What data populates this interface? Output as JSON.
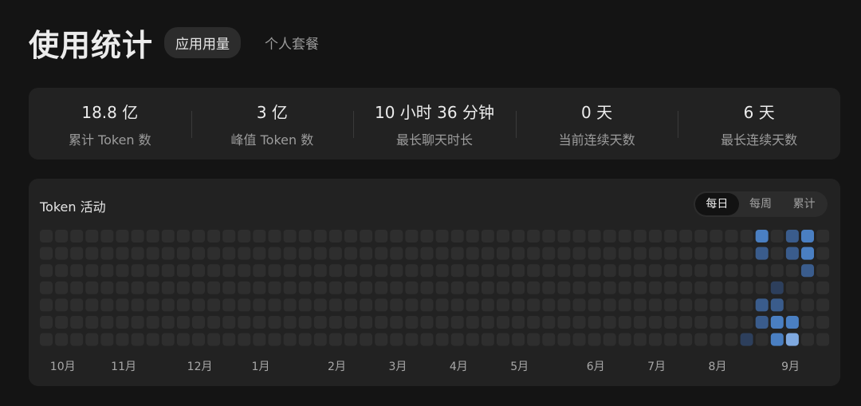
{
  "header": {
    "title": "使用统计",
    "tabs": [
      {
        "label": "应用用量",
        "active": true
      },
      {
        "label": "个人套餐",
        "active": false
      }
    ]
  },
  "stats": [
    {
      "value": "18.8 亿",
      "label": "累计 Token 数"
    },
    {
      "value": "3 亿",
      "label": "峰值 Token 数"
    },
    {
      "value": "10 小时 36 分钟",
      "label": "最长聊天时长"
    },
    {
      "value": "0 天",
      "label": "当前连续天数"
    },
    {
      "value": "6 天",
      "label": "最长连续天数"
    }
  ],
  "activity": {
    "title": "Token 活动",
    "range_options": [
      {
        "label": "每日",
        "active": true
      },
      {
        "label": "每周",
        "active": false
      },
      {
        "label": "累计",
        "active": false
      }
    ],
    "weeks": 52,
    "days_per_week": 7,
    "months": [
      {
        "label": "10月",
        "week": 1.5
      },
      {
        "label": "11月",
        "week": 5.5
      },
      {
        "label": "12月",
        "week": 10.5
      },
      {
        "label": "1月",
        "week": 14.5
      },
      {
        "label": "2月",
        "week": 19.5
      },
      {
        "label": "3月",
        "week": 23.5
      },
      {
        "label": "4月",
        "week": 27.5
      },
      {
        "label": "5月",
        "week": 31.5
      },
      {
        "label": "6月",
        "week": 36.5
      },
      {
        "label": "7月",
        "week": 40.5
      },
      {
        "label": "8月",
        "week": 44.5
      },
      {
        "label": "9月",
        "week": 49.3
      }
    ],
    "active_cells": [
      {
        "week": 46,
        "day": 6,
        "level": 1
      },
      {
        "week": 47,
        "day": 0,
        "level": 3
      },
      {
        "week": 47,
        "day": 1,
        "level": 2
      },
      {
        "week": 47,
        "day": 4,
        "level": 2
      },
      {
        "week": 47,
        "day": 5,
        "level": 2
      },
      {
        "week": 48,
        "day": 3,
        "level": 1
      },
      {
        "week": 48,
        "day": 4,
        "level": 2
      },
      {
        "week": 48,
        "day": 5,
        "level": 3
      },
      {
        "week": 48,
        "day": 6,
        "level": 3
      },
      {
        "week": 49,
        "day": 0,
        "level": 2
      },
      {
        "week": 49,
        "day": 1,
        "level": 2
      },
      {
        "week": 49,
        "day": 5,
        "level": 3
      },
      {
        "week": 49,
        "day": 6,
        "level": 4
      },
      {
        "week": 50,
        "day": 0,
        "level": 3
      },
      {
        "week": 50,
        "day": 1,
        "level": 3
      },
      {
        "week": 50,
        "day": 2,
        "level": 2
      }
    ],
    "colors": {
      "empty": "#2e2e2e",
      "level1": "#2d3f5c",
      "level2": "#3a5c8c",
      "level3": "#4a7fc2",
      "level4": "#7fa9e0"
    }
  }
}
